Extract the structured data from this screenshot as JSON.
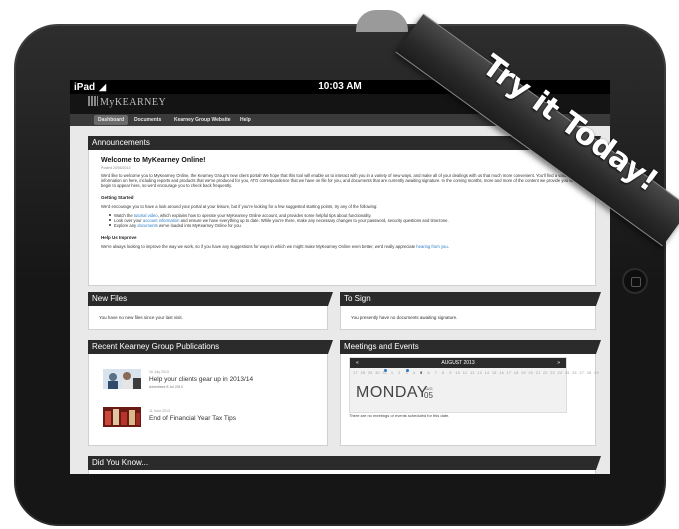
{
  "device": {
    "status_bar": {
      "carrier": "iPad",
      "time": "10:03 AM"
    }
  },
  "app": {
    "logo_text": "MyKEARNEY",
    "nav_tabs": [
      "Dashboard",
      "Documents",
      "Kearney Group Website",
      "Help"
    ],
    "active_tab": "Dashboard"
  },
  "announcements": {
    "header": "Announcements",
    "title": "Welcome to MyKearney Online!",
    "date": "Posted 20/05/2013",
    "intro": "We'd like to welcome you to MyKearney Online, the Kearney Group's new client portal! We hope that this tool will enable us to interact with you in a variety of new ways, and make all of your dealings with us that much more convenient. You'll find a variety of information on here, including reports and products that we've produced for you, ATO correspondence that we have on file for you, and documents that are currently awaiting signature. In the coming months, more and more of the content we provide you will begin to appear here, so we'd encourage you to check back frequently.",
    "getting_started_heading": "Getting Started",
    "getting_started_text": "We'd encourage you to have a look around your portal at your leisure, but if you're looking for a few suggested starting points, try any of the following:",
    "bullets": [
      {
        "pre": "Watch the ",
        "link": "tutorial video",
        "post": ", which explains how to operate your MyKearney Online account, and provides some helpful tips about functionality."
      },
      {
        "pre": "Look over your ",
        "link": "account information",
        "post": " and ensure we have everything up to date. While you're there, make any necessary changes to your password, security questions and timezone."
      },
      {
        "pre": "Explore any ",
        "link": "documents",
        "post": " we've loaded into MyKearney Online for you."
      }
    ],
    "help_heading": "Help Us Improve",
    "help_text_pre": "We're always looking to improve the way we work, so if you have any suggestions for ways in which we might make MyKearney Online even better, we'd really appreciate ",
    "help_link": "hearing from you",
    "help_text_post": "."
  },
  "new_files": {
    "header": "New Files",
    "text": "You have no new files since your last visit."
  },
  "to_sign": {
    "header": "To Sign",
    "text": "You presently have no documents awaiting signature."
  },
  "publications": {
    "header": "Recent Kearney Group Publications",
    "items": [
      {
        "date": "16 July 2013",
        "title": "Help your clients gear up in 2013/14",
        "subtitle": "Advertisee 8 Jul 2013"
      },
      {
        "date": "11 June 2013",
        "title": "End of Financial Year Tax Tips",
        "subtitle": ""
      }
    ]
  },
  "events": {
    "header": "Meetings and Events",
    "month": "AUGUST 2013",
    "days": [
      "27",
      "28",
      "29",
      "30",
      "31",
      "1",
      "2",
      "3",
      "4",
      "5",
      "6",
      "7",
      "8",
      "9",
      "10",
      "11",
      "12",
      "13",
      "14",
      "15",
      "16",
      "17",
      "18",
      "19",
      "20",
      "21",
      "22",
      "23",
      "24",
      "25",
      "26",
      "27",
      "28",
      "29"
    ],
    "today_index": 9,
    "weekday": "MONDAY",
    "month_short": "AUG",
    "day_number": "05",
    "note": "There are no meetings or events scheduled for this date."
  },
  "did_you_know": {
    "header": "Did You Know..."
  },
  "ribbon": {
    "text": "Try it Today!"
  }
}
